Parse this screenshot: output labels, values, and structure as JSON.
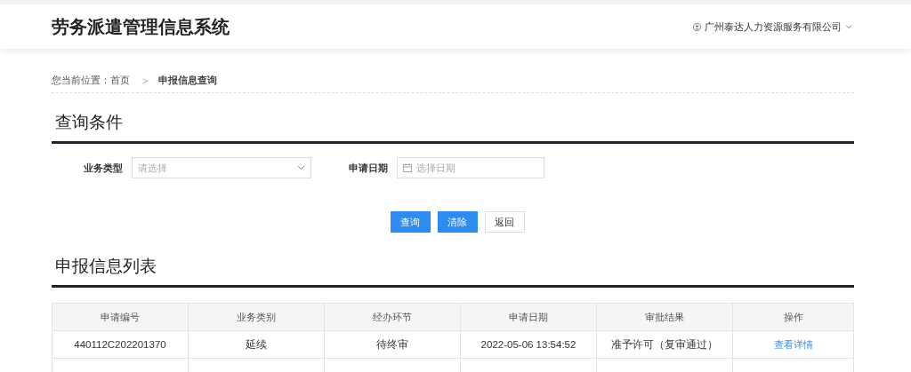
{
  "header": {
    "title": "劳务派遣管理信息系统",
    "company": "广州泰达人力资源服务有限公司"
  },
  "breadcrumb": {
    "prefix": "您当前位置：",
    "home": "首页",
    "separator": ">",
    "current": "申报信息查询"
  },
  "query": {
    "title": "查询条件",
    "fields": [
      {
        "kind": "select",
        "label": "业务类型",
        "placeholder": "请选择"
      },
      {
        "kind": "date",
        "label": "申请日期",
        "placeholder": "选择日期"
      }
    ],
    "buttons": [
      {
        "label": "查询",
        "kind": "primary"
      },
      {
        "label": "清除",
        "kind": "primary"
      },
      {
        "label": "返回",
        "kind": "default"
      }
    ]
  },
  "list": {
    "title": "申报信息列表",
    "columns": [
      "申请编号",
      "业务类别",
      "经办环节",
      "申请日期",
      "审批结果",
      "操作"
    ],
    "rows": [
      {
        "cells": [
          "440112C202201370",
          "延续",
          "待终审",
          "2022-05-06 13:54:52",
          "准予许可（复审通过）"
        ],
        "action": "查看详情"
      }
    ]
  }
}
